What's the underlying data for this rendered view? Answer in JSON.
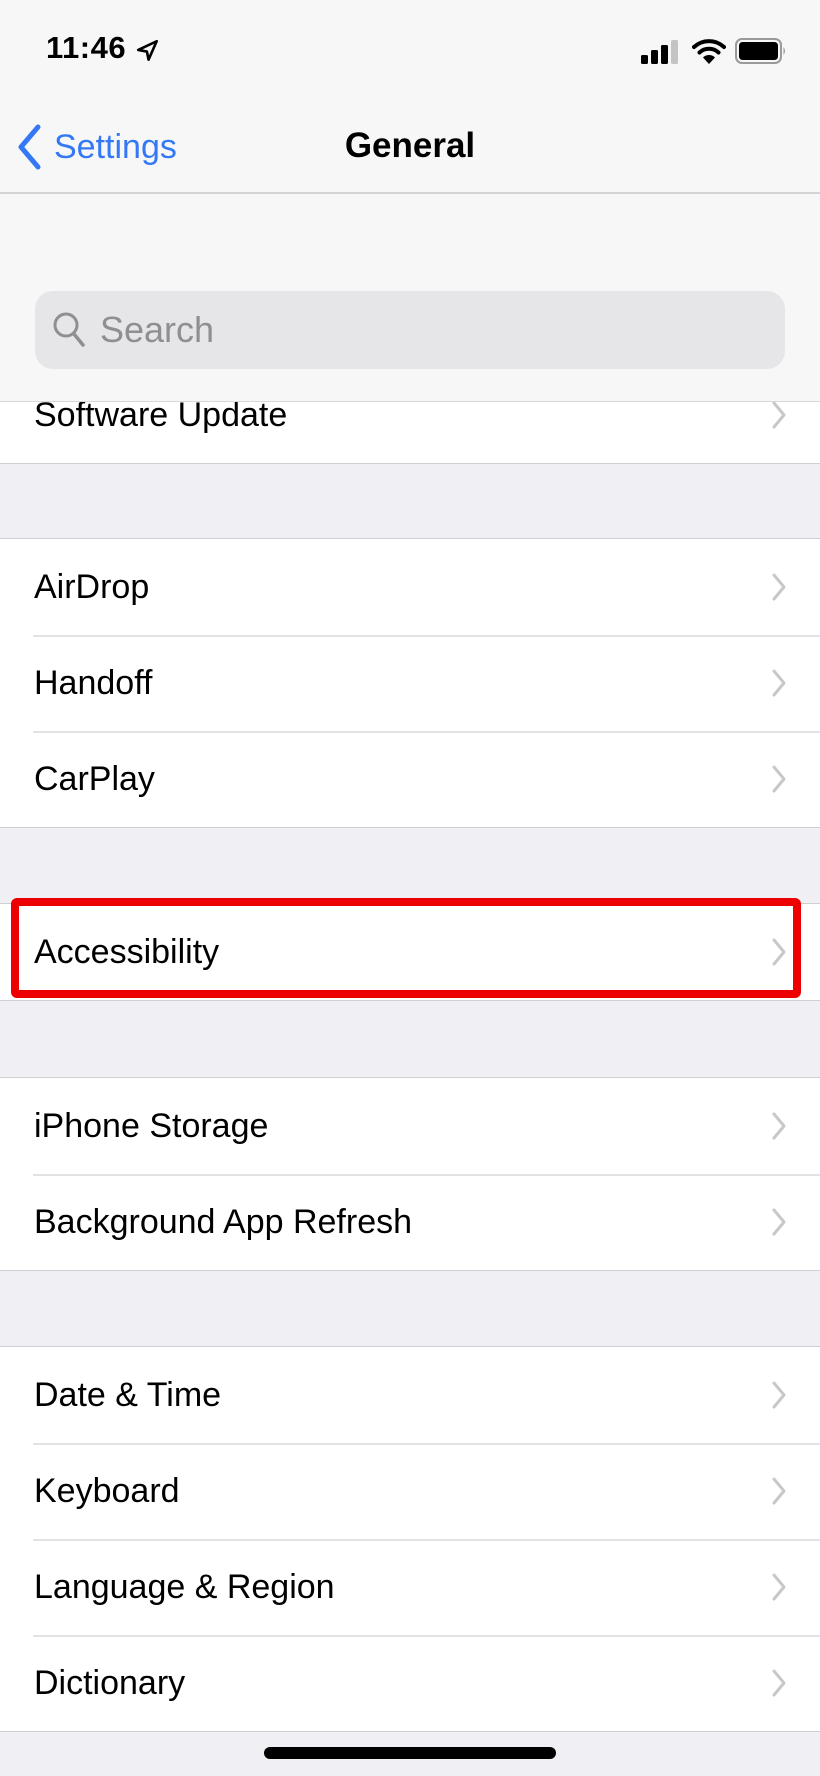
{
  "status_bar": {
    "time": "11:46",
    "location_icon": "location-arrow-icon",
    "signal_icon": "cellular-signal-icon",
    "signal_bars_filled": 3,
    "signal_bars_total": 4,
    "wifi_icon": "wifi-icon",
    "battery_icon": "battery-icon",
    "battery_level": 1.0
  },
  "nav": {
    "back_label": "Settings",
    "back_icon": "chevron-left-icon",
    "title": "General"
  },
  "search": {
    "placeholder": "Search",
    "value": "",
    "icon": "search-icon"
  },
  "groups": [
    {
      "rows": [
        {
          "label": "Software Update"
        }
      ]
    },
    {
      "rows": [
        {
          "label": "AirDrop"
        },
        {
          "label": "Handoff"
        },
        {
          "label": "CarPlay"
        }
      ]
    },
    {
      "rows": [
        {
          "label": "Accessibility",
          "highlighted": true
        }
      ]
    },
    {
      "rows": [
        {
          "label": "iPhone Storage"
        },
        {
          "label": "Background App Refresh"
        }
      ]
    },
    {
      "rows": [
        {
          "label": "Date & Time"
        },
        {
          "label": "Keyboard"
        },
        {
          "label": "Language & Region"
        },
        {
          "label": "Dictionary"
        }
      ]
    }
  ],
  "colors": {
    "accent": "#3478f6",
    "highlight": "#ee0000",
    "background": "#efeff4",
    "chevron": "#c7c7cc"
  }
}
